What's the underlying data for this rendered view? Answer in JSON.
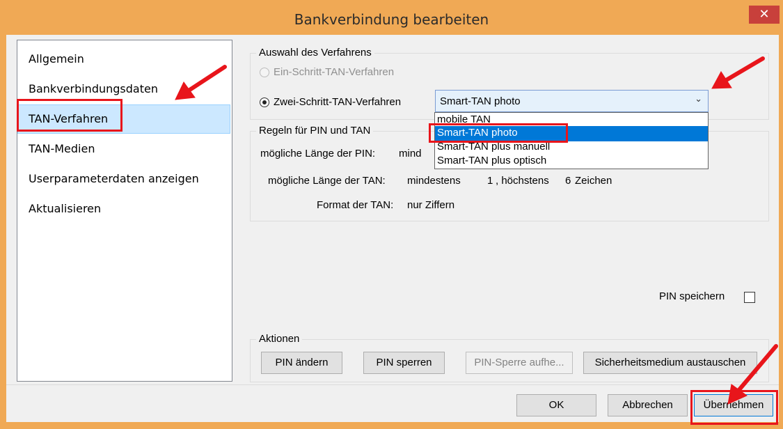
{
  "window": {
    "title": "Bankverbindung bearbeiten",
    "close_label": "✕"
  },
  "sidebar": {
    "items": [
      {
        "label": "Allgemein"
      },
      {
        "label": "Bankverbindungsdaten"
      },
      {
        "label": "TAN-Verfahren",
        "selected": true
      },
      {
        "label": "TAN-Medien"
      },
      {
        "label": "Userparameterdaten anzeigen"
      },
      {
        "label": "Aktualisieren"
      }
    ]
  },
  "procedure": {
    "group_title": "Auswahl des Verfahrens",
    "option_one_step": "Ein-Schritt-TAN-Verfahren",
    "option_two_step": "Zwei-Schritt-TAN-Verfahren",
    "selected_value": "Smart-TAN photo",
    "dropdown_options": [
      "mobile TAN",
      "Smart-TAN photo",
      "Smart-TAN plus manuell",
      "Smart-TAN plus optisch"
    ]
  },
  "rules": {
    "group_title": "Regeln für PIN und TAN",
    "pin_length_label": "mögliche Länge der PIN:",
    "pin_length_value": "mind",
    "tan_length_label": "mögliche Länge der TAN:",
    "tan_min_word": "mindestens",
    "tan_min": "1",
    "tan_max_word": ", höchstens",
    "tan_max": "6",
    "tan_unit": "Zeichen",
    "tan_format_label": "Format der TAN:",
    "tan_format_value": "nur Ziffern"
  },
  "pin_save": {
    "label": "PIN speichern"
  },
  "actions": {
    "group_title": "Aktionen",
    "change_pin": "PIN ändern",
    "lock_pin": "PIN sperren",
    "unlock_pin": "PIN-Sperre aufhe...",
    "swap_medium": "Sicherheitsmedium austauschen"
  },
  "footer": {
    "ok": "OK",
    "cancel": "Abbrechen",
    "apply": "Übernehmen"
  },
  "colors": {
    "titlebar": "#f0a955",
    "close_button": "#c8403b",
    "selection": "#cce8ff",
    "dropdown_selection": "#0078d7",
    "annotation": "#e8151b"
  }
}
